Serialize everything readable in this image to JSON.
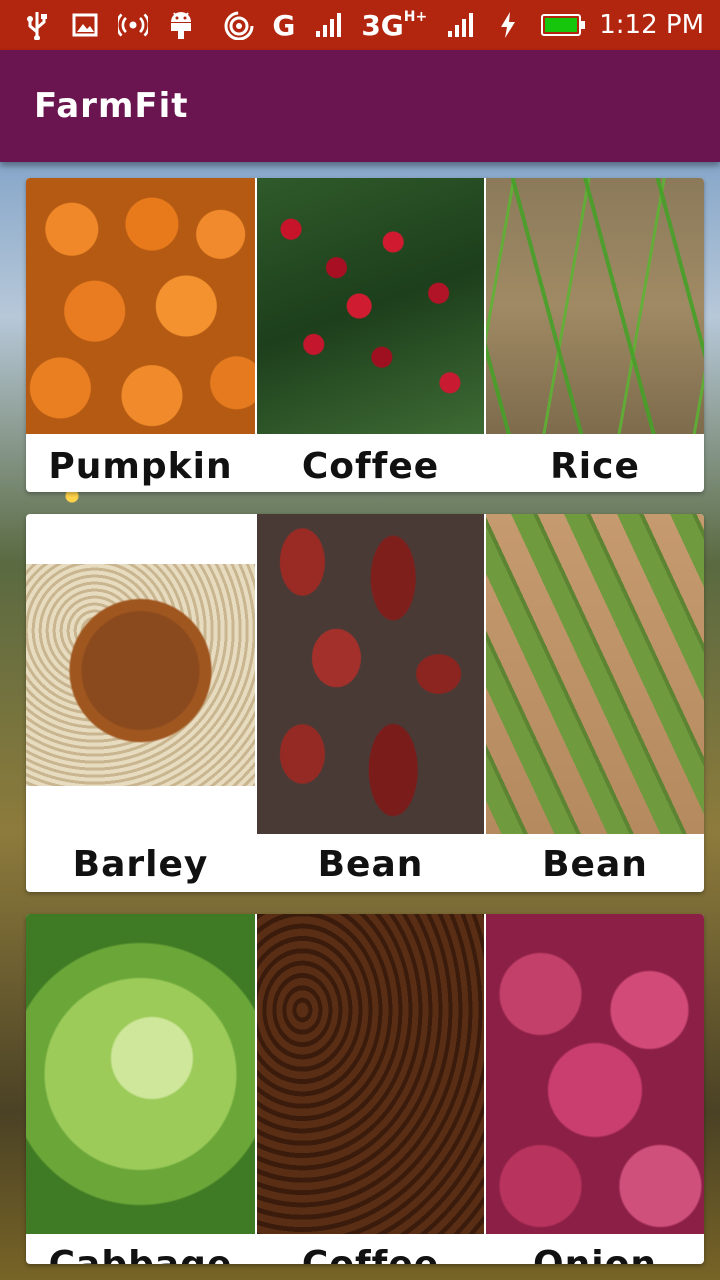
{
  "status_bar": {
    "icons": [
      "usb-icon",
      "image-icon",
      "hotspot-icon",
      "android-icon",
      "wifi-hotspot-icon",
      "signal-icon",
      "charging-icon",
      "battery-icon"
    ],
    "network_g": "G",
    "network_3g": "3G",
    "network_3g_sup": "H+",
    "time": "1:12 PM"
  },
  "app": {
    "title": "FarmFit"
  },
  "crops": [
    {
      "label": "Pumpkin"
    },
    {
      "label": "Coffee"
    },
    {
      "label": "Rice"
    },
    {
      "label": "Barley"
    },
    {
      "label": "Bean"
    },
    {
      "label": "Bean"
    },
    {
      "label": "Cabbage"
    },
    {
      "label": "Coffee"
    },
    {
      "label": "Onion"
    }
  ]
}
